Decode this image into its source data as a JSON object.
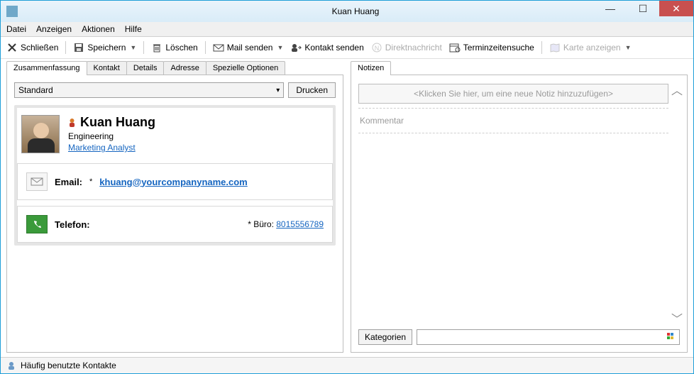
{
  "window": {
    "title": "Kuan Huang"
  },
  "menu": {
    "items": [
      "Datei",
      "Anzeigen",
      "Aktionen",
      "Hilfe"
    ]
  },
  "toolbar": {
    "close": "Schließen",
    "save": "Speichern",
    "delete": "Löschen",
    "mail": "Mail senden",
    "contact": "Kontakt senden",
    "dm": "Direktnachricht",
    "timesearch": "Terminzeitensuche",
    "showmap": "Karte anzeigen"
  },
  "left": {
    "tabs": [
      "Zusammenfassung",
      "Kontakt",
      "Details",
      "Adresse",
      "Spezielle Optionen"
    ],
    "std_option": "Standard",
    "print": "Drucken",
    "name": "Kuan Huang",
    "dept": "Engineering",
    "role": "Marketing Analyst",
    "email_label": "Email:",
    "email_star": "*",
    "email": "khuang@yourcompanyname.com",
    "phone_label": "Telefon:",
    "phone_type": "* Büro:",
    "phone": "8015556789"
  },
  "right": {
    "tab": "Notizen",
    "placeholder": "<Klicken Sie hier, um eine neue Notiz hinzuzufügen>",
    "comment": "Kommentar",
    "categories": "Kategorien"
  },
  "status": {
    "text": "Häufig benutzte Kontakte"
  }
}
